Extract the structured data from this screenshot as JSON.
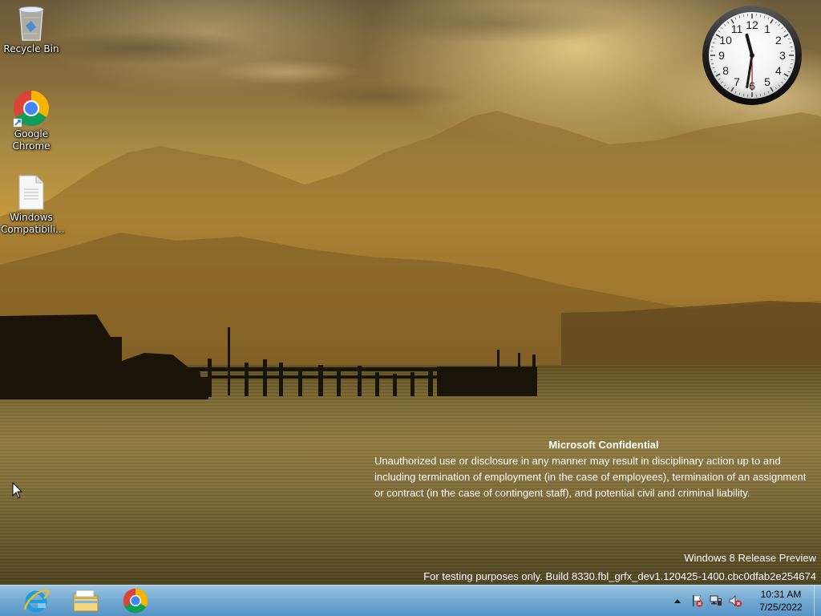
{
  "desktop": {
    "icons": [
      {
        "label": "Recycle Bin",
        "icon": "recycle-bin-icon"
      },
      {
        "label": "Google Chrome",
        "label_line1": "Google",
        "label_line2": "Chrome",
        "icon": "chrome-icon"
      },
      {
        "label": "Windows Compatibili...",
        "label_line1": "Windows",
        "label_line2": "Compatibili...",
        "icon": "document-icon"
      }
    ]
  },
  "clock_gadget": {
    "hour": 11,
    "minute": 31,
    "second": 30,
    "numerals": [
      "12",
      "1",
      "2",
      "3",
      "4",
      "5",
      "6",
      "7",
      "8",
      "9",
      "10",
      "11"
    ]
  },
  "watermark": {
    "confidential_title": "Microsoft Confidential",
    "confidential_body": "Unauthorized use or disclosure in any manner may result in disciplinary action up to and including termination of employment (in the case of employees), termination of an assignment or contract (in the case of contingent staff), and potential civil and criminal liability.",
    "edition": "Windows 8 Release Preview",
    "build": "For testing purposes only. Build 8330.fbl_grfx_dev1.120425-1400.cbc0dfab2e254674"
  },
  "taskbar": {
    "pinned": [
      {
        "name": "Internet Explorer",
        "icon": "internet-explorer-icon"
      },
      {
        "name": "File Explorer",
        "icon": "file-explorer-icon"
      },
      {
        "name": "Google Chrome",
        "icon": "chrome-icon"
      }
    ],
    "tray": {
      "icons": [
        "show-hidden-icons-arrow",
        "action-center-flag-icon",
        "network-icon",
        "volume-muted-icon"
      ],
      "time": "10:31 AM",
      "date": "7/25/2022"
    }
  },
  "colors": {
    "taskbar": "#78b4e1",
    "chrome_red": "#db4437",
    "chrome_yellow": "#f4b400",
    "chrome_green": "#0f9d58",
    "chrome_blue": "#4285f4",
    "ie_blue": "#1b9de2"
  }
}
